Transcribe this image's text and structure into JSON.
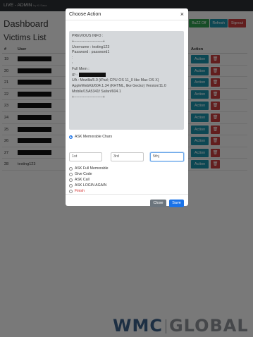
{
  "topnav": {
    "title": "LIVE - ADMIN",
    "subtitle": "by Ki Sasa"
  },
  "page": {
    "title": "Dashboard",
    "buttons": [
      {
        "label": "BuZZ Off",
        "color": "#2e9b4d"
      },
      {
        "label": "Refresh",
        "color": "#1b8fa6"
      },
      {
        "label": "Signout",
        "color": "#c53c3c"
      }
    ],
    "section_title": "Victims List"
  },
  "table": {
    "headers": {
      "num": "#",
      "user": "User",
      "action": "Action"
    },
    "rows": [
      {
        "num": "19",
        "user": "",
        "action": "Action",
        "delete_icon": "trash-icon"
      },
      {
        "num": "20",
        "user": "",
        "action": "Action",
        "delete_icon": "trash-icon"
      },
      {
        "num": "21",
        "user": "",
        "action": "Action",
        "delete_icon": "trash-icon"
      },
      {
        "num": "22",
        "user": "",
        "action": "Action",
        "delete_icon": "trash-icon"
      },
      {
        "num": "23",
        "user": "",
        "action": "Action",
        "delete_icon": "trash-icon"
      },
      {
        "num": "24",
        "user": "",
        "action": "Action",
        "delete_icon": "trash-icon"
      },
      {
        "num": "25",
        "user": "",
        "action": "Action",
        "delete_icon": "trash-icon"
      },
      {
        "num": "26",
        "user": "",
        "action": "Action",
        "delete_icon": "trash-icon"
      },
      {
        "num": "27",
        "user": "",
        "action": "Action",
        "delete_icon": "trash-icon"
      },
      {
        "num": "28",
        "user": "testing123",
        "action": "Action",
        "delete_icon": "trash-icon"
      }
    ]
  },
  "modal": {
    "title": "Choose Action",
    "close_glyph": "×",
    "info": {
      "heading": "PREVIOUS INFO :",
      "divider": "+-----------------------+",
      "username": "Username : testing123",
      "password": "Password : password1",
      "blank1": ":",
      "blank2": ":",
      "full_mem": "Full Mem :",
      "ip_label": "IP :",
      "ua": "UA : Mozilla/5.0 (iPad; CPU OS 11_0 like Mac OS X) AppleWebKit/604.1.34 (KHTML, like Gecko) Version/11.0 Mobile/15A5341f Safari/604.1",
      "divider2": "+-----------------------+"
    },
    "selected_option": "ASK Memorable Chars",
    "fields": [
      {
        "value": "1st"
      },
      {
        "value": "3rd"
      },
      {
        "value": "5thj"
      }
    ],
    "options": [
      "ASK Full Memorable",
      "Give Code",
      "ASK Call",
      "ASK LOGIN AGAIN",
      "Finish"
    ],
    "close_label": "Close",
    "save_label": "Save"
  },
  "watermark": {
    "part1": "WMC",
    "part2": "GLOBAL"
  },
  "colors": {
    "primary": "#1a73e8",
    "teal": "#1b8fa6",
    "danger": "#c53c3c",
    "success": "#2e9b4d"
  }
}
